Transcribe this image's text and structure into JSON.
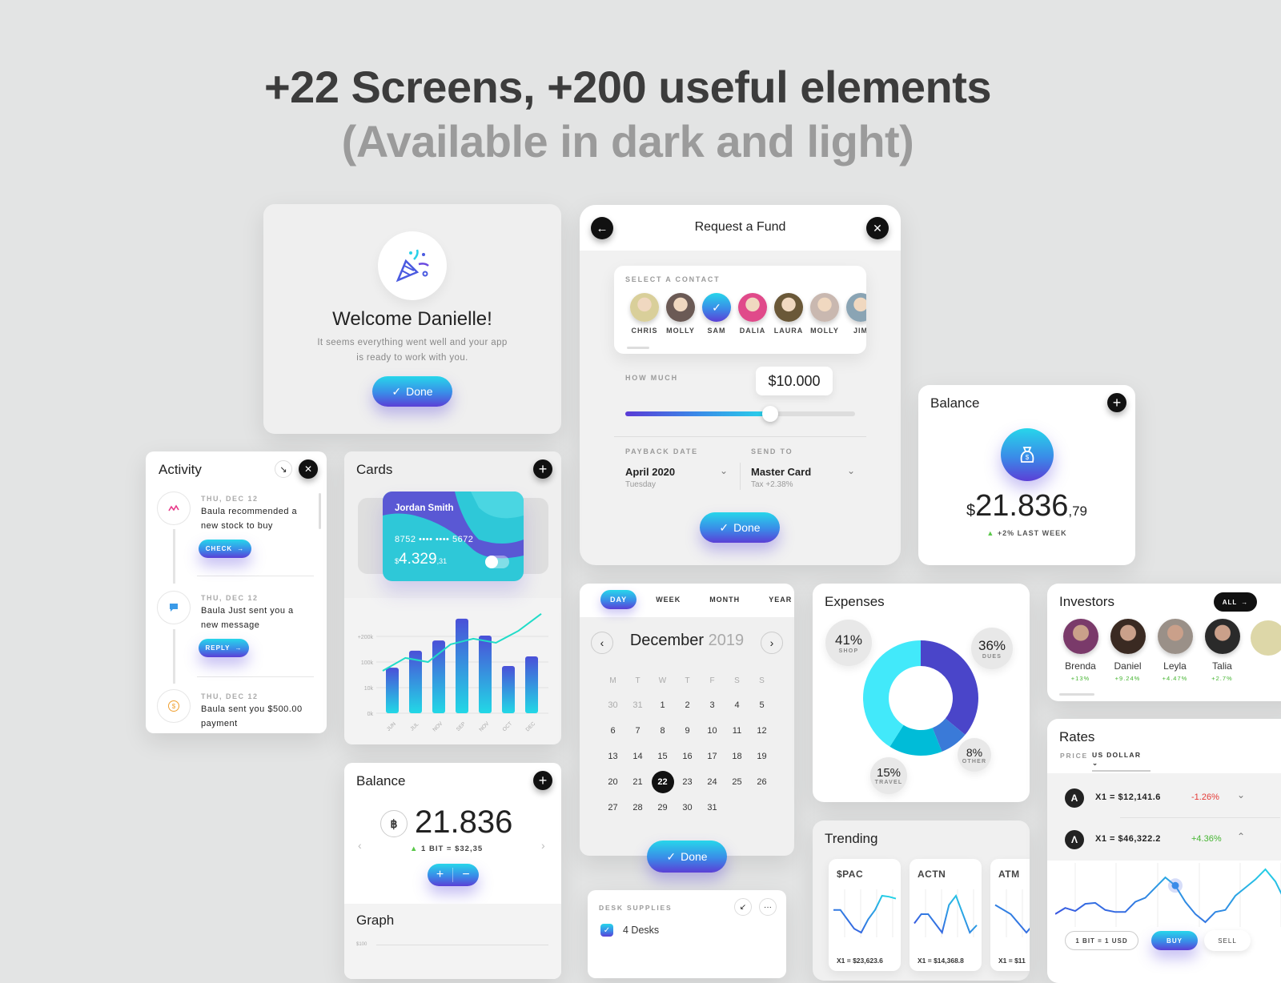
{
  "headline": {
    "line1": "+22 Screens, +200 useful elements",
    "line2": "(Available in dark and light)"
  },
  "welcome": {
    "title": "Welcome Danielle!",
    "text1": "It seems everything went well and your app",
    "text2": "is ready to work with you.",
    "done": "Done",
    "icon": "party-popper-icon"
  },
  "request": {
    "title": "Request a Fund",
    "select_label": "SELECT A CONTACT",
    "contacts": [
      {
        "name": "CHRIS",
        "color": "#d9cf9a"
      },
      {
        "name": "MOLLY",
        "color": "#6b5a55"
      },
      {
        "name": "SAM",
        "selected": true
      },
      {
        "name": "DALIA",
        "color": "#e04a8a"
      },
      {
        "name": "LAURA",
        "color": "#6a5838"
      },
      {
        "name": "MOLLY",
        "color": "#c9b8b0"
      },
      {
        "name": "JIM",
        "color": "#8aa4b4"
      }
    ],
    "how_much_label": "HOW MUCH",
    "amount": "$10.000",
    "slider_fraction": 0.63,
    "payback_label": "PAYBACK DATE",
    "payback_value": "April 2020",
    "payback_sub": "Tuesday",
    "send_label": "SEND TO",
    "send_value": "Master Card",
    "send_sub": "Tax +2.38%",
    "done": "Done"
  },
  "balance_right": {
    "title": "Balance",
    "currency": "$",
    "amount": "21.836",
    "cents": ",79",
    "change": "+2% LAST WEEK",
    "icon": "money-bag-icon"
  },
  "activity": {
    "title": "Activity",
    "items": [
      {
        "date": "THU, DEC 12",
        "text": "Baula recommended a new stock to buy",
        "button": "CHECK",
        "icon": "pulse-icon"
      },
      {
        "date": "THU, DEC 12",
        "text": "Baula Just sent you a new message",
        "button": "REPLY",
        "icon": "chat-icon"
      },
      {
        "date": "THU, DEC 12",
        "text": "Baula sent you $500.00 payment",
        "icon": "dollar-coin-icon"
      }
    ]
  },
  "cards": {
    "title": "Cards",
    "holder": "Jordan Smith",
    "number": "8752 •••• •••• 5672",
    "currency": "$",
    "amount": "4.329",
    "cents": ",31"
  },
  "chart_data": [
    {
      "type": "bar",
      "categories": [
        "JUN",
        "JUL",
        "NOV",
        "SEP",
        "NOV",
        "OCT",
        "DEC"
      ],
      "values": [
        80000,
        144000,
        184000,
        269000,
        203000,
        86000,
        122000
      ],
      "line_series": [
        69000,
        116000,
        100000,
        169000,
        191000,
        175000,
        222000,
        288000
      ],
      "yticks": [
        "0k",
        "10k",
        "100k",
        "+200k"
      ],
      "ytick_values": [
        0,
        10000,
        100000,
        200000
      ],
      "grid": true
    },
    {
      "type": "pie",
      "hole": true,
      "slices": [
        {
          "label": "DUES",
          "value": 36,
          "color": "#4a45c9"
        },
        {
          "label": "OTHER",
          "value": 8,
          "color": "#3a7ad8"
        },
        {
          "label": "TRAVEL",
          "value": 15,
          "color": "#00bcd8"
        },
        {
          "label": "SHOP",
          "value": 41,
          "color": "#42e9fa"
        }
      ]
    },
    {
      "type": "line",
      "name": "$PAC",
      "values": [
        5,
        5,
        4,
        3,
        2.6,
        4,
        5,
        6.5,
        6.4,
        6.2
      ]
    },
    {
      "type": "line",
      "name": "ACTN",
      "values": [
        4,
        5,
        5,
        4,
        3,
        6,
        7,
        5,
        3,
        3.8
      ]
    },
    {
      "type": "line",
      "name": "ATM",
      "values": [
        5,
        4,
        2,
        4,
        6
      ]
    },
    {
      "type": "line",
      "values": [
        3,
        3.6,
        3.3,
        4,
        4.1,
        3.4,
        3.2,
        3.2,
        4.2,
        4.6,
        5.6,
        6.6,
        5.8,
        4.2,
        3,
        2.2,
        3.2,
        3.4,
        4.8,
        5.6,
        6.4,
        7.4,
        6.2,
        4.2,
        3.4
      ]
    }
  ],
  "balance_small": {
    "title": "Balance",
    "amount": "21.836",
    "rate": "1 BIT = $32,35",
    "plus": "+",
    "minus": "−",
    "graph_title": "Graph",
    "graph_tick": "$100"
  },
  "calendar": {
    "tabs": [
      "DAY",
      "WEEK",
      "MONTH",
      "YEAR"
    ],
    "active_tab": 0,
    "month": "December",
    "year": "2019",
    "weekdays": [
      "M",
      "T",
      "W",
      "T",
      "F",
      "S",
      "S"
    ],
    "weeks": [
      [
        "30",
        "31",
        "1",
        "2",
        "3",
        "4",
        "5"
      ],
      [
        "6",
        "7",
        "8",
        "9",
        "10",
        "11",
        "12"
      ],
      [
        "13",
        "14",
        "15",
        "16",
        "17",
        "18",
        "19"
      ],
      [
        "20",
        "21",
        "22",
        "23",
        "24",
        "25",
        "26"
      ],
      [
        "27",
        "28",
        "29",
        "30",
        "31",
        "",
        ""
      ]
    ],
    "selected": "22",
    "done": "Done"
  },
  "desk": {
    "label": "DESK SUPPLIES",
    "item": "4 Desks",
    "checked": true
  },
  "expenses": {
    "title": "Expenses",
    "shop": "41%",
    "shop_l": "SHOP",
    "dues": "36%",
    "dues_l": "DUES",
    "other": "8%",
    "other_l": "OTHER",
    "travel": "15%",
    "travel_l": "TRAVEL"
  },
  "trending": {
    "title": "Trending",
    "items": [
      {
        "ticker": "$PAC",
        "value": "X1 = $23,623.6"
      },
      {
        "ticker": "ACTN",
        "value": "X1 = $14,368.8"
      },
      {
        "ticker": "ATM",
        "value": "X1 = $11"
      }
    ]
  },
  "investors": {
    "title": "Investors",
    "all": "ALL",
    "people": [
      {
        "name": "Brenda",
        "change": "+13%",
        "color": "#7a3a6a"
      },
      {
        "name": "Daniel",
        "change": "+9.24%",
        "color": "#3a2a22"
      },
      {
        "name": "Leyla",
        "change": "+4.47%",
        "color": "#9a9088"
      },
      {
        "name": "Talia",
        "change": "+2.7%",
        "color": "#2a2a2a"
      }
    ]
  },
  "rates": {
    "title": "Rates",
    "price_label": "PRICE",
    "currency": "US DOLLAR",
    "rows": [
      {
        "value": "X1 = $12,141.6",
        "change": "-1.26%",
        "color": "#e53935"
      },
      {
        "value": "X1 = $46,322.2",
        "change": "+4.36%",
        "color": "#45b531"
      }
    ],
    "unit": "1 BIT = 1 USD",
    "buy": "BUY",
    "sell": "SELL"
  }
}
